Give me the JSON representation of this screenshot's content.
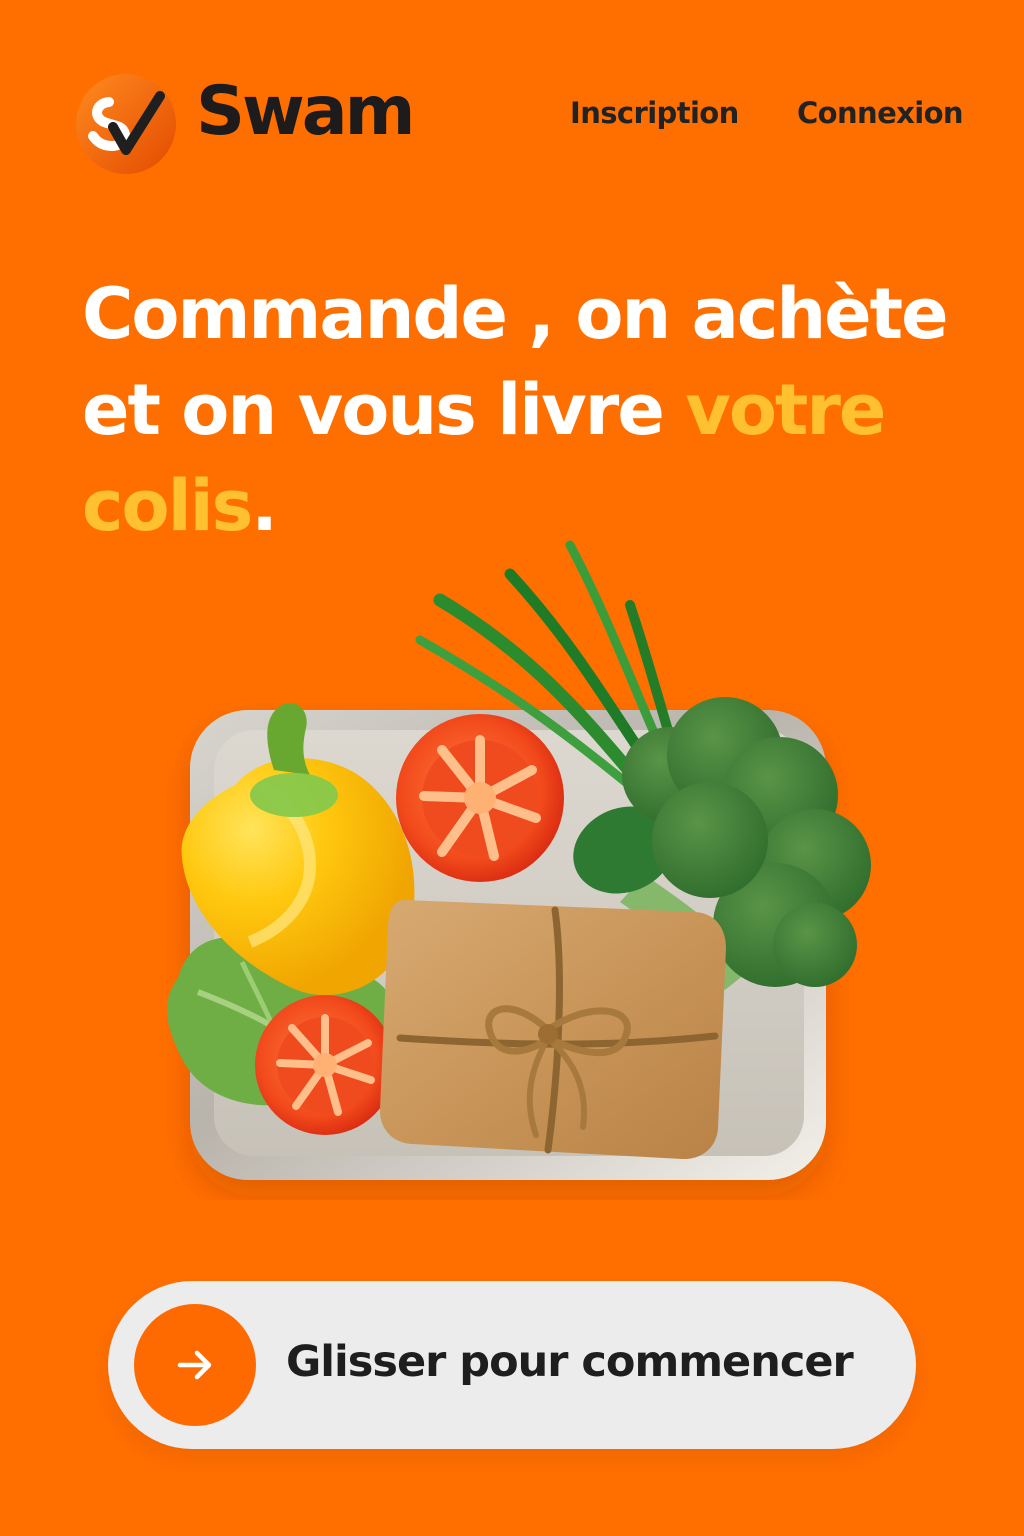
{
  "brand": {
    "name": "Swam",
    "logo_mark": "SV",
    "logo_icon": "swam-logo-icon",
    "colors": {
      "primary": "#ff6f00",
      "accent": "#ffc12f",
      "text": "#1d1b1b",
      "button_bg": "#ececec",
      "button_knob": "#ff6a00"
    }
  },
  "header": {
    "nav": {
      "signup": "Inscription",
      "login": "Connexion"
    }
  },
  "hero": {
    "headline_part1": "Commande , on achète et on vous livre ",
    "headline_highlight": "votre colis",
    "headline_end": "."
  },
  "cta": {
    "label": "Glisser pour commencer",
    "icon": "arrow-right-icon"
  },
  "illustration": {
    "items": [
      "yellow-bell-pepper",
      "tomato-half",
      "green-onion",
      "broccoli",
      "lettuce-leaf",
      "kraft-paper-package",
      "metal-tray"
    ]
  }
}
